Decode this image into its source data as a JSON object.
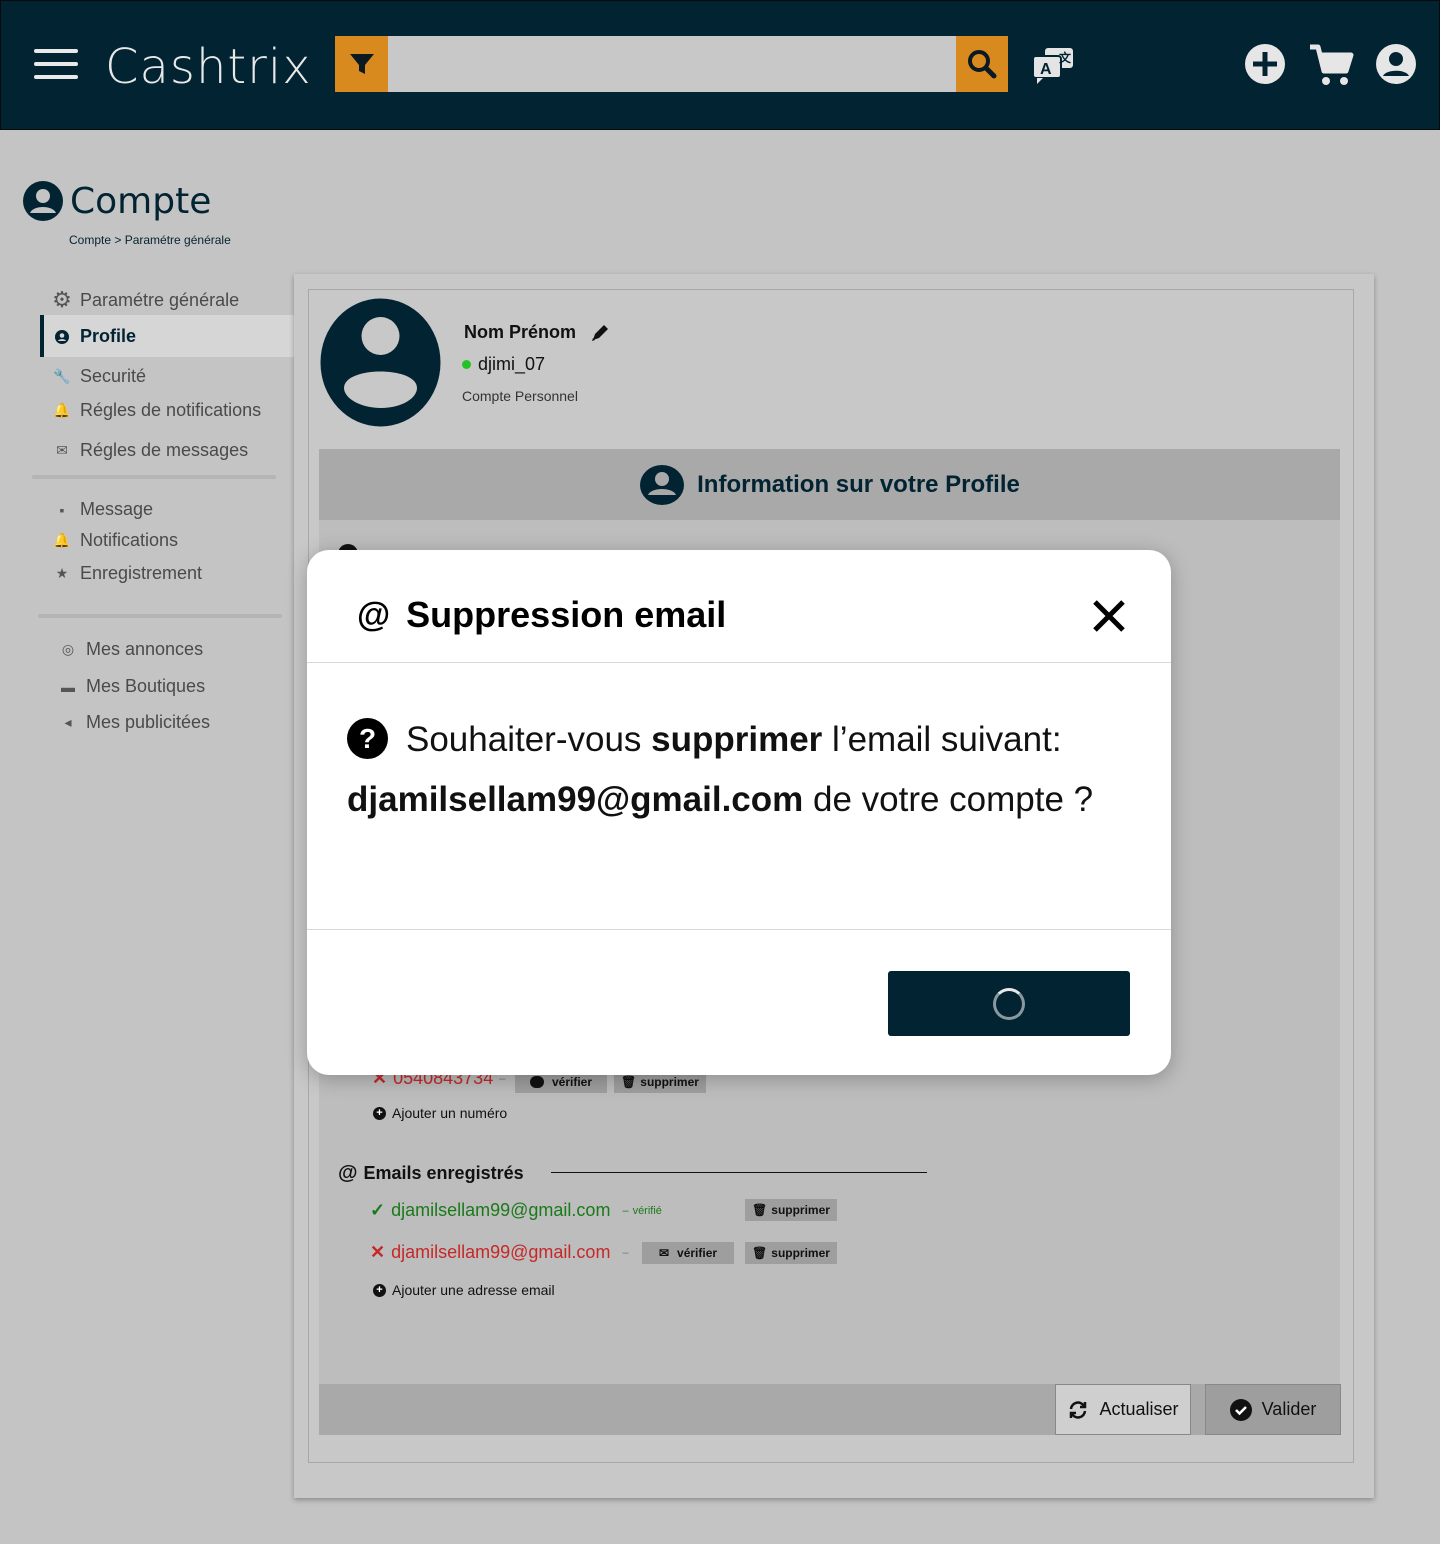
{
  "header": {
    "brand": "Cashtrix",
    "search": {
      "placeholder": "",
      "value": ""
    },
    "icons": [
      "menu-icon",
      "filter-icon",
      "search-icon",
      "translate-icon",
      "add-icon",
      "cart-icon",
      "account-icon"
    ]
  },
  "page": {
    "title": "Compte",
    "breadcrumb": "Compte > Paramétre générale"
  },
  "sidebar": {
    "section_title": "Paramétre générale",
    "items": [
      {
        "label": "Profile",
        "icon": "user-icon",
        "active": true
      },
      {
        "label": "Securité",
        "icon": "key-icon"
      },
      {
        "label": "Régles de notifications",
        "icon": "bell-rule-icon"
      },
      {
        "label": "Régles de messages",
        "icon": "message-rule-icon"
      },
      {
        "label": "Message",
        "icon": "message-icon"
      },
      {
        "label": "Notifications",
        "icon": "bell-icon"
      },
      {
        "label": "Enregistrement",
        "icon": "star-icon"
      },
      {
        "label": "Mes annonces",
        "icon": "announce-icon"
      },
      {
        "label": "Mes Boutiques",
        "icon": "store-icon"
      },
      {
        "label": "Mes publicitées",
        "icon": "megaphone-icon"
      }
    ]
  },
  "profile": {
    "name": "Nom Prénom",
    "username": "djimi_07",
    "account_type": "Compte Personnel",
    "info_header": "Information sur votre Profile"
  },
  "phones": {
    "number": "0540843734",
    "separator": "–",
    "verify_label": "vérifier",
    "delete_label": "supprimer",
    "add_label": "Ajouter un numéro"
  },
  "emails": {
    "title": "Emails enregistrés",
    "items": [
      {
        "address": "djamilsellam99@gmail.com",
        "status": "vérifié",
        "verified": true,
        "delete_label": "supprimer"
      },
      {
        "address": "djamilsellam99@gmail.com",
        "verified": false,
        "verify_label": "vérifier",
        "delete_label": "supprimer"
      }
    ],
    "separator": "–",
    "add_label": "Ajouter une adresse email"
  },
  "footer": {
    "refresh_label": "Actualiser",
    "validate_label": "Valider"
  },
  "modal": {
    "title": "Suppression email",
    "text_before": "Souhaiter-vous ",
    "text_bold": "supprimer",
    "text_after": " l’email suivant:",
    "email": "djamilsellam99@gmail.com",
    "text_end": " de votre compte ?"
  },
  "colors": {
    "primary": "#022332",
    "accent": "#d98a1e",
    "verified": "#1a7a1a",
    "error": "#c62828",
    "online": "#22c322"
  }
}
